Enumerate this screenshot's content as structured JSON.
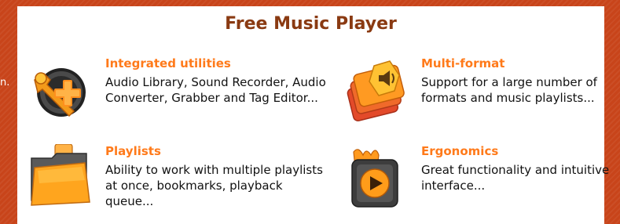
{
  "edge_fragment": "n.",
  "title": "Free Music Player",
  "features": [
    {
      "heading": "Integrated utilities",
      "description": "Audio Library, Sound Recorder, Audio Converter, Grabber and Tag Editor...",
      "icon": "wrench-plus-icon"
    },
    {
      "heading": "Multi-format",
      "description": "Support for a large number of formats and music playlists...",
      "icon": "stacked-formats-icon"
    },
    {
      "heading": "Playlists",
      "description": "Ability to work with multiple playlists at once, bookmarks, playback queue...",
      "icon": "folder-icon"
    },
    {
      "heading": "Ergonomics",
      "description": "Great functionality and intuitive interface...",
      "icon": "play-button-icon"
    }
  ],
  "colors": {
    "background": "#c8441a",
    "title": "#8a3a12",
    "heading": "#ff7a1a",
    "text": "#111111"
  }
}
